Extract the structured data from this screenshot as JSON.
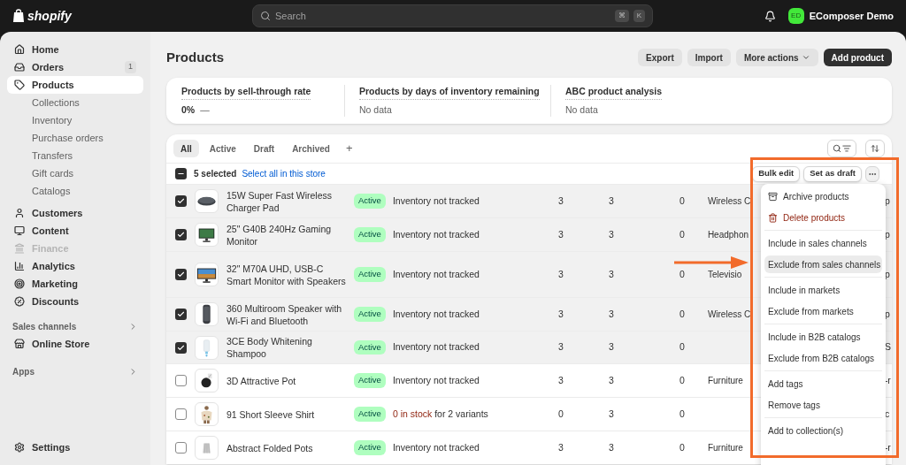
{
  "top_bar": {
    "logo": "shopify",
    "search": {
      "placeholder": "Search",
      "shortcut": [
        "⌘",
        "K"
      ]
    },
    "account": {
      "initials": "ED",
      "name": "EComposer Demo"
    }
  },
  "sidebar": {
    "items": [
      {
        "label": "Home",
        "selected": false,
        "disabled": false
      },
      {
        "label": "Orders",
        "selected": false,
        "disabled": false,
        "badge": "1"
      },
      {
        "label": "Products",
        "selected": true,
        "disabled": false,
        "children": [
          {
            "label": "Collections"
          },
          {
            "label": "Inventory"
          },
          {
            "label": "Purchase orders"
          },
          {
            "label": "Transfers"
          },
          {
            "label": "Gift cards"
          },
          {
            "label": "Catalogs"
          }
        ]
      },
      {
        "label": "Customers",
        "selected": false,
        "disabled": false
      },
      {
        "label": "Content",
        "selected": false,
        "disabled": false
      },
      {
        "label": "Finance",
        "selected": false,
        "disabled": true
      },
      {
        "label": "Analytics",
        "selected": false,
        "disabled": false
      },
      {
        "label": "Marketing",
        "selected": false,
        "disabled": false
      },
      {
        "label": "Discounts",
        "selected": false,
        "disabled": false
      }
    ],
    "sections": [
      {
        "title": "Sales channels",
        "items": [
          {
            "label": "Online Store"
          }
        ]
      },
      {
        "title": "Apps"
      }
    ],
    "settings": "Settings"
  },
  "page": {
    "title": "Products",
    "actions": [
      {
        "label": "Export",
        "kind": "secondary"
      },
      {
        "label": "Import",
        "kind": "secondary"
      },
      {
        "label": "More actions",
        "kind": "menu"
      },
      {
        "label": "Add product",
        "kind": "primary"
      }
    ]
  },
  "metrics": [
    {
      "title": "Products by sell-through rate",
      "value": "0%",
      "trend": "—"
    },
    {
      "title": "Products by days of inventory remaining",
      "value": "No data"
    },
    {
      "title": "ABC product analysis",
      "value": "No data"
    }
  ],
  "table": {
    "tabs": [
      {
        "label": "All",
        "selected": true
      },
      {
        "label": "Active",
        "selected": false
      },
      {
        "label": "Draft",
        "selected": false
      },
      {
        "label": "Archived",
        "selected": false
      }
    ],
    "add_tab": "+",
    "selection": {
      "indeterminate": true,
      "count": "5 selected",
      "link": "Select all in this store"
    },
    "bulk_actions": [
      "Bulk edit",
      "Set as draft"
    ],
    "rows": [
      {
        "checked": true,
        "name": "15W Super Fast Wireless Charger Pad",
        "status": "Active",
        "inventory": "Inventory not tracked",
        "column_4": "3",
        "column_5": "3",
        "column_6": "0",
        "category": "Wireless C",
        "column_8": "p"
      },
      {
        "checked": true,
        "name": "25\" G40B 240Hz Gaming Monitor",
        "status": "Active",
        "inventory": "Inventory not tracked",
        "column_4": "3",
        "column_5": "3",
        "column_6": "0",
        "category": "Headphon",
        "column_8": "p"
      },
      {
        "checked": true,
        "name": "32\" M70A UHD, USB-C Smart Monitor with Speakers",
        "status": "Active",
        "inventory": "Inventory not tracked",
        "column_4": "3",
        "column_5": "3",
        "column_6": "0",
        "category": "Televisio",
        "column_8": "p"
      },
      {
        "checked": true,
        "name": "360 Multiroom Speaker with Wi-Fi and Bluetooth",
        "status": "Active",
        "inventory": "Inventory not tracked",
        "column_4": "3",
        "column_5": "3",
        "column_6": "0",
        "category": "Wireless C",
        "column_8": "p"
      },
      {
        "checked": true,
        "name": "3CE Body Whitening Shampoo",
        "status": "Active",
        "inventory": "Inventory not tracked",
        "column_4": "3",
        "column_5": "3",
        "column_6": "0",
        "column_8": "S"
      },
      {
        "checked": false,
        "name": "3D Attractive Pot",
        "status": "Active",
        "inventory": "Inventory not tracked",
        "column_4": "3",
        "column_5": "3",
        "column_6": "0",
        "category": "Furniture",
        "column_8": "-r"
      },
      {
        "checked": false,
        "name": "91 Short Sleeve Shirt",
        "status": "Active",
        "inventory_warning": "0 in stock",
        "inventory": "for 2 variants",
        "column_4": "0",
        "column_5": "3",
        "column_6": "0",
        "column_8": "c"
      },
      {
        "checked": false,
        "name": "Abstract Folded Pots",
        "status": "Active",
        "inventory": "Inventory not tracked",
        "column_4": "3",
        "column_5": "3",
        "column_6": "0",
        "category": "Furniture",
        "column_8": "-r"
      }
    ]
  },
  "actions_menu": {
    "groups": [
      [
        {
          "label": "Archive products",
          "kind": "archive",
          "selected": false
        },
        {
          "label": "Delete products",
          "kind": "danger",
          "selected": false
        }
      ],
      [
        {
          "label": "Include in sales channels",
          "kind": "plain",
          "selected": false
        },
        {
          "label": "Exclude from sales channels",
          "kind": "plain",
          "selected": true
        }
      ],
      [
        {
          "label": "Include in markets",
          "kind": "plain",
          "selected": false
        },
        {
          "label": "Exclude from markets",
          "kind": "plain",
          "selected": false
        }
      ],
      [
        {
          "label": "Include in B2B catalogs",
          "kind": "plain",
          "selected": false
        },
        {
          "label": "Exclude from B2B catalogs",
          "kind": "plain",
          "selected": false
        }
      ],
      [
        {
          "label": "Add tags",
          "kind": "plain",
          "selected": false
        },
        {
          "label": "Remove tags",
          "kind": "plain",
          "selected": false
        }
      ],
      [
        {
          "label": "Add to collection(s)",
          "kind": "plain",
          "selected": false
        }
      ]
    ]
  }
}
